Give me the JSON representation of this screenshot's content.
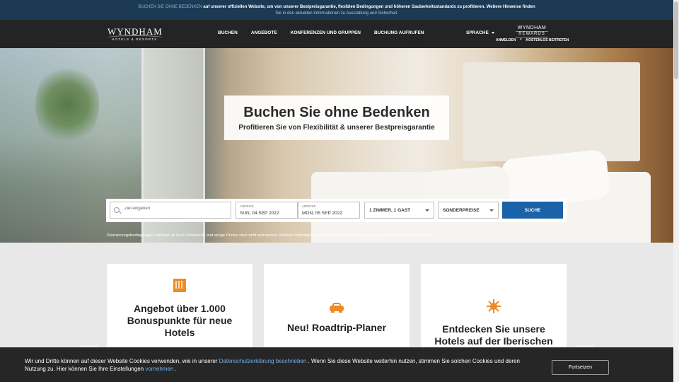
{
  "notice": {
    "link_text": "BUCHEN SIE OHNE BEDENKEN",
    "text": "auf unserer offiziellen Website, um von unserer Bestpreisgarantie, flexiblen Bedingungen und höheren Sauberkeitsstandards zu profitieren. Weitere Hinweise finden",
    "line2": "Sie in den aktuellen Informationen zu Ausstattung und Sicherheit."
  },
  "header": {
    "logo_main": "WYNDHAM",
    "logo_sub": "HOTELS & RESORTS",
    "nav": [
      "BUCHEN",
      "ANGEBOTE",
      "KONFERENZEN UND GRUPPEN",
      "BUCHUNG AUFRUFEN"
    ],
    "language": "SPRACHE",
    "rewards_line1": "WYNDHAM",
    "rewards_line2": "REWARDS",
    "sign_in": "ANMELDEN",
    "join": "KOSTENLOS BEITRETEN"
  },
  "hero": {
    "title": "Buchen Sie ohne Bedenken",
    "subtitle": "Profitieren Sie von Flexibilität & unserer Bestpreisgarantie"
  },
  "search": {
    "destination_placeholder": "Ziel eingeben",
    "checkin_label": "ANREISE",
    "checkin_value": "SUN, 04 SEP 2022",
    "checkout_label": "ABREISE",
    "checkout_value": "MON, 05 SEP 2022",
    "rooms": "1 ZIMMER, 1 GAST",
    "rates": "SONDERPREISE",
    "button": "SUCHE"
  },
  "disclaimer": "Stornierungsbedingungen variieren je nach Unterkunft und einige Preise sind nicht stornierbar. Weitere Informationen finden Sie beim Buchen unter „Zusätzliche Preisinformationen\".",
  "cards": [
    {
      "title": "Angebot über 1.000 Bonuspunkte für neue Hotels",
      "icon": "building-icon"
    },
    {
      "title": "Neu! Roadtrip-Planer",
      "icon": "car-icon"
    },
    {
      "title": "Entdecken Sie unsere Hotels auf der Iberischen Halbinsel",
      "icon": "sun-icon"
    }
  ],
  "cookie": {
    "text1": "Wir und Dritte können auf dieser Website Cookies verwenden, wie in unserer",
    "link1": "Datenschutzerklärung beschrieben",
    "text2": ". Wenn Sie diese Website weiterhin nutzen, stimmen Sie solchen Cookies und deren Nutzung zu. Hier können Sie Ihre Einstellungen",
    "link2": "vornehmen",
    "text3": ".",
    "button": "Fortsetzen"
  },
  "colors": {
    "notice_bg": "#1c3a54",
    "header_bg": "#242424",
    "accent_orange": "#f08a24",
    "search_button": "#1b63a8",
    "cookie_bg": "#262626"
  }
}
